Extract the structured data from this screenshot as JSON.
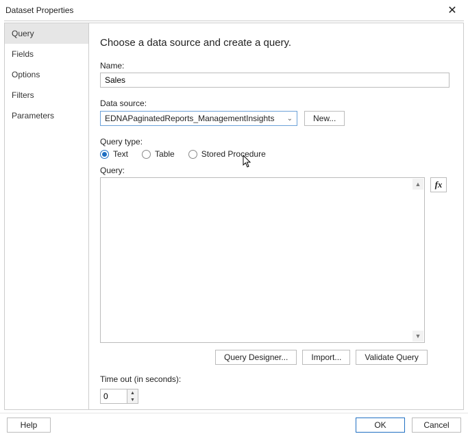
{
  "window": {
    "title": "Dataset Properties"
  },
  "sidebar": {
    "items": [
      {
        "label": "Query",
        "active": true
      },
      {
        "label": "Fields"
      },
      {
        "label": "Options"
      },
      {
        "label": "Filters"
      },
      {
        "label": "Parameters"
      }
    ]
  },
  "content": {
    "heading": "Choose a data source and create a query.",
    "name_label": "Name:",
    "name_value": "Sales",
    "datasource_label": "Data source:",
    "datasource_value": "EDNAPaginatedReports_ManagementInsights",
    "new_button": "New...",
    "querytype_label": "Query type:",
    "radios": {
      "text": "Text",
      "table": "Table",
      "stored": "Stored Procedure"
    },
    "query_label": "Query:",
    "query_value": "",
    "fx_label": "fx",
    "query_designer": "Query Designer...",
    "import": "Import...",
    "validate": "Validate Query",
    "timeout_label": "Time out (in seconds):",
    "timeout_value": "0"
  },
  "footer": {
    "help": "Help",
    "ok": "OK",
    "cancel": "Cancel"
  }
}
